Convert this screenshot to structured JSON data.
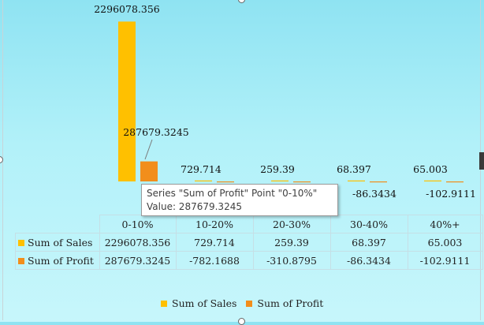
{
  "chart_data": {
    "type": "bar",
    "categories": [
      "0-10%",
      "10-20%",
      "20-30%",
      "30-40%",
      "40%+"
    ],
    "series": [
      {
        "name": "Sum of Sales",
        "color": "#ffc000",
        "values": [
          2296078.356,
          729.714,
          259.39,
          68.397,
          65.003
        ],
        "labels": [
          "2296078.356",
          "729.714",
          "259.39",
          "68.397",
          "65.003"
        ]
      },
      {
        "name": "Sum of Profit",
        "color": "#f28e1b",
        "values": [
          287679.3245,
          -782.1688,
          -310.8795,
          -86.3434,
          -102.9111
        ],
        "labels": [
          "287679.3245",
          "-782.1688",
          "-310.8795",
          "-86.3434",
          "-102.9111"
        ]
      }
    ],
    "ylim": [
      0,
      2300000
    ],
    "legend": "bottom",
    "data_table": true
  },
  "tooltip": {
    "line1": "Series \"Sum of Profit\" Point \"0-10%\"",
    "line2": "Value: 287679.3245"
  }
}
